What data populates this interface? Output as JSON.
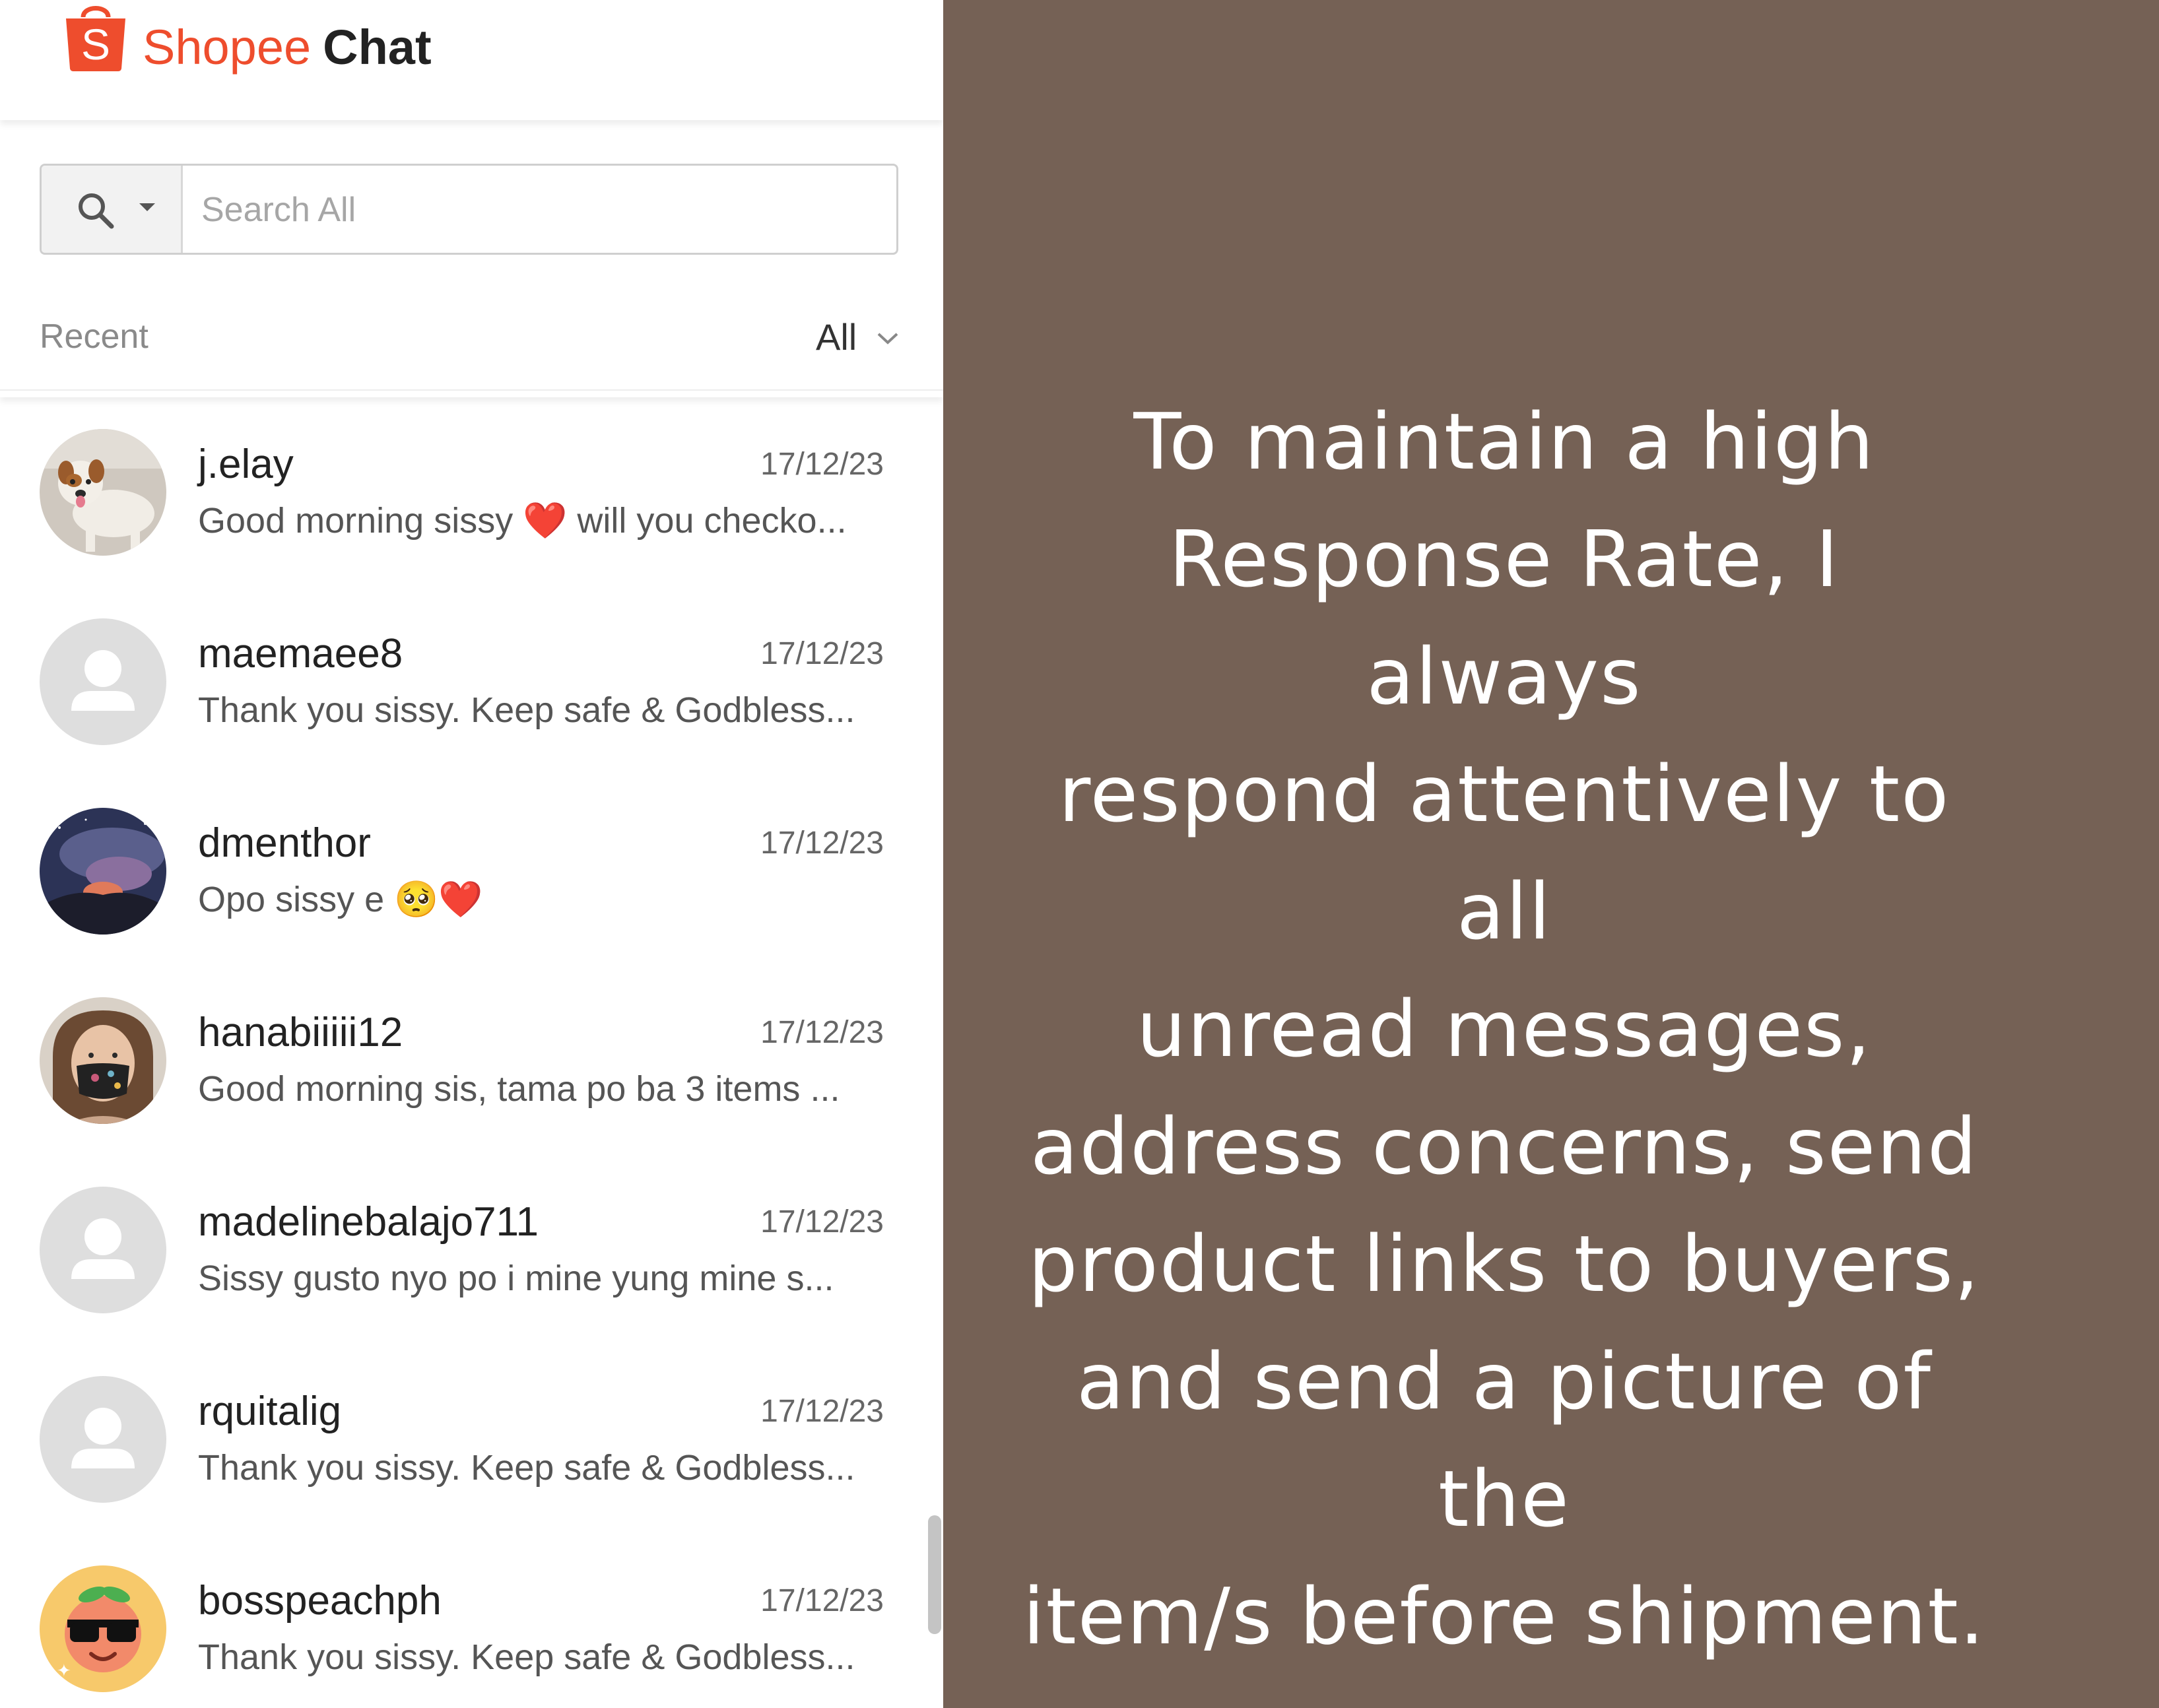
{
  "header": {
    "brand_name": "Shopee",
    "product_name": "Chat",
    "logo_letter": "S",
    "brand_color": "#ee4d2d"
  },
  "search": {
    "placeholder": "Search All",
    "value": ""
  },
  "filter": {
    "section_label": "Recent",
    "selected": "All"
  },
  "conversations": [
    {
      "name": "j.elay",
      "date": "17/12/23",
      "preview": "Good morning sissy ❤️ will you checko...",
      "avatar": "dog-photo"
    },
    {
      "name": "maemaee8",
      "date": "17/12/23",
      "preview": "Thank you sissy. Keep safe & Godbless...",
      "avatar": "default-person"
    },
    {
      "name": "dmenthor",
      "date": "17/12/23",
      "preview": "Opo sissy e 🥺❤️",
      "avatar": "volcano-photo"
    },
    {
      "name": "hanabiiiii12",
      "date": "17/12/23",
      "preview": "Good morning sis, tama po ba 3 items ...",
      "avatar": "person-mask-photo"
    },
    {
      "name": "madelinebalajo711",
      "date": "17/12/23",
      "preview": "Sissy gusto nyo po i mine yung mine s...",
      "avatar": "default-person"
    },
    {
      "name": "rquitalig",
      "date": "17/12/23",
      "preview": "Thank you sissy. Keep safe & Godbless...",
      "avatar": "default-person"
    },
    {
      "name": "bosspeachph",
      "date": "17/12/23",
      "preview": "Thank you sissy. Keep safe & Godbless...",
      "avatar": "peach-sunglasses"
    }
  ],
  "message_panel": {
    "background_color": "#756155",
    "text_lines": [
      "To maintain a high",
      "Response Rate, I always",
      "respond attentively to all",
      "unread messages,",
      "address concerns, send",
      "product links to buyers,",
      "and send a picture of the",
      "item/s before shipment."
    ]
  }
}
